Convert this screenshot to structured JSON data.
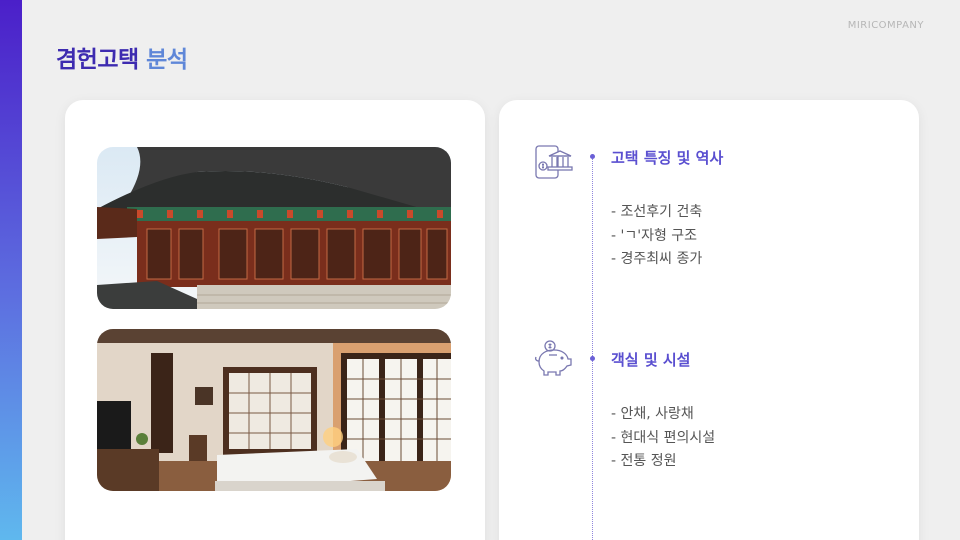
{
  "brand": "MIRICOMPANY",
  "title": {
    "part1": "겸헌고택",
    "part2": "분석"
  },
  "colors": {
    "accent": "#5a4fd0",
    "title_primary": "#3d2bb0",
    "title_secondary": "#5f87d8",
    "sidebar_top": "#4b1fc9",
    "sidebar_bottom": "#5fb8ee"
  },
  "images": {
    "exterior": "hanok-exterior-photo",
    "interior": "hanok-bedroom-photo"
  },
  "sections": [
    {
      "icon": "bank-icon",
      "heading": "고택 특징 및 역사",
      "items": [
        "- 조선후기 건축",
        "- 'ㄱ'자형 구조",
        "- 경주최씨 종가"
      ]
    },
    {
      "icon": "piggy-bank-icon",
      "heading": "객실 및 시설",
      "items": [
        "- 안채, 사랑채",
        "- 현대식 편의시설",
        "- 전통 정원"
      ]
    }
  ]
}
